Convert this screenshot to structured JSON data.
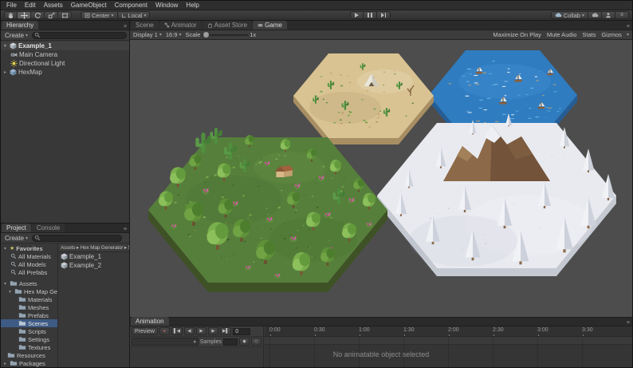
{
  "menu": {
    "items": [
      "File",
      "Edit",
      "Assets",
      "GameObject",
      "Component",
      "Window",
      "Help"
    ]
  },
  "toolbar": {
    "pivot_label": "Center",
    "space_label": "Local",
    "collab_label": "Collab"
  },
  "hierarchy": {
    "tab": "Hierarchy",
    "create_label": "Create",
    "scene_name": "Example_1",
    "children": [
      "Main Camera",
      "Directional Light",
      "HexMap"
    ]
  },
  "view_tabs": {
    "scene": "Scene",
    "animator": "Animator",
    "asset_store": "Asset Store",
    "game": "Game"
  },
  "game_bar": {
    "display": "Display 1",
    "aspect": "16:9",
    "scale_label": "Scale",
    "scale_value": "1x",
    "maximize_on_play": "Maximize On Play",
    "mute_audio": "Mute Audio",
    "stats": "Stats",
    "gizmos": "Gizmos"
  },
  "project": {
    "tab_project": "Project",
    "tab_console": "Console",
    "create_label": "Create",
    "favorites_label": "Favorites",
    "favorites": [
      "All Materials",
      "All Models",
      "All Prefabs"
    ],
    "root_assets": "Assets",
    "folder_hexmap": "Hex Map Generator",
    "subfolders": [
      "Materials",
      "Meshes",
      "Prefabs",
      "Scenes",
      "Scripts",
      "Settings",
      "Textures"
    ],
    "folder_resources": "Resources",
    "root_packages": "Packages",
    "breadcrumb": "Assets ▸ Hex Map Generator ▸ Scenes",
    "files": [
      "Example_1",
      "Example_2"
    ]
  },
  "animation": {
    "tab": "Animation",
    "preview_label": "Preview",
    "frame_value": "0",
    "samples_label": "Samples",
    "empty_message": "No animatable object selected",
    "ticks": [
      "0:00",
      "0:30",
      "1:00",
      "1:30",
      "2:00",
      "2:30",
      "3:00",
      "3:30"
    ]
  },
  "icons": {
    "caret": "▾",
    "expanded": "▾",
    "collapsed": "▸",
    "star": "★",
    "menu": "≡",
    "record": "●",
    "t_first": "▌◀",
    "t_prev": "◀",
    "t_play": "▶",
    "t_next": "▶",
    "t_last": "▶▌",
    "key_icon": "◆",
    "event_icon": "◇"
  }
}
